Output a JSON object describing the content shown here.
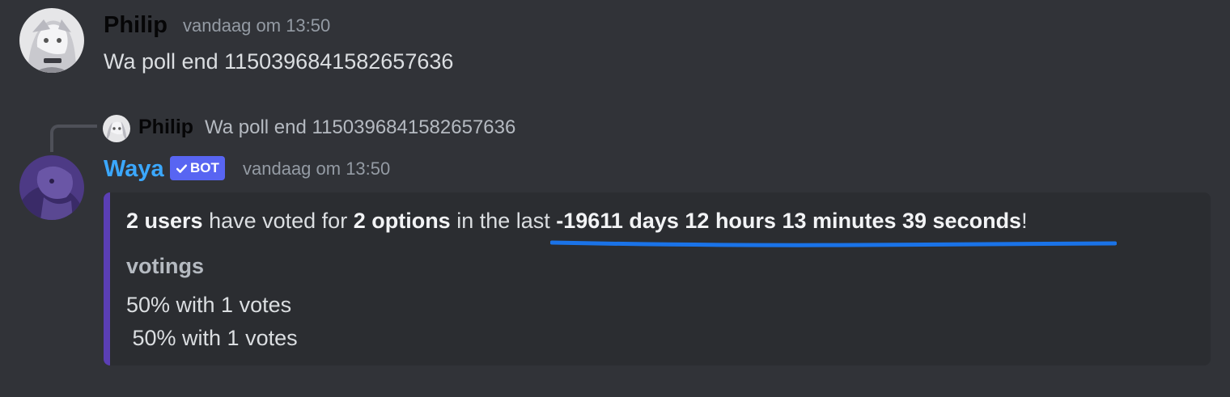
{
  "message1": {
    "author": "Philip",
    "author_color": "#060607",
    "timestamp": "vandaag om 13:50",
    "content": "Wa poll end 1150396841582657636"
  },
  "reply": {
    "author": "Philip",
    "text": "Wa poll end 1150396841582657636"
  },
  "message2": {
    "author": "Waya",
    "author_color": "#3ba8ff",
    "bot_tag": "BOT",
    "timestamp": "vandaag om 13:50",
    "embed": {
      "accent_color": "#5b3fb5",
      "desc": {
        "users": "2 users",
        "voted_for": " have voted for ",
        "options": "2 options",
        "in_last": " in the last ",
        "duration": "-19611 days 12 hours 13 minutes 39 seconds",
        "end": "!"
      },
      "field_name": "votings",
      "field_lines": [
        "50% with 1 votes",
        " 50% with 1 votes"
      ]
    }
  },
  "annotation": {
    "underline_color": "#1a73e8"
  }
}
